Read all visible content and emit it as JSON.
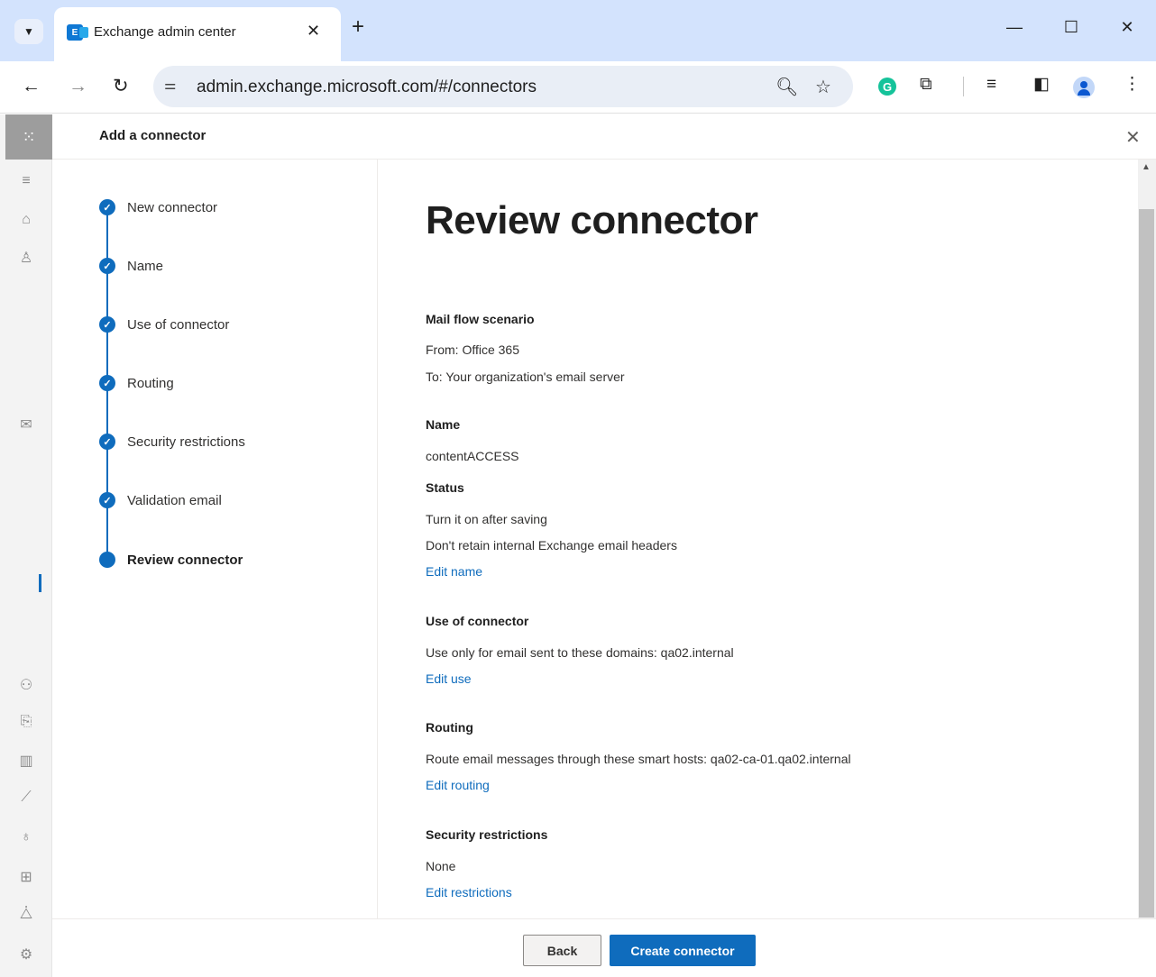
{
  "browser": {
    "tab_title": "Exchange admin center",
    "favicon_letter": "E",
    "url": "admin.exchange.microsoft.com/#/connectors",
    "icons": {
      "tab_dropdown": "chevron-down-icon",
      "tab_close": "close-icon",
      "new_tab": "plus-icon",
      "minimize": "minimize-icon",
      "maximize": "maximize-icon",
      "window_close": "close-icon",
      "back": "arrow-left-icon",
      "forward": "arrow-right-icon",
      "reload": "reload-icon",
      "site_info": "tune-icon",
      "zoom": "zoom-icon",
      "bookmark": "star-icon",
      "grammarly": "grammarly-icon",
      "extensions": "puzzle-icon",
      "media": "media-control-icon",
      "side_panel": "side-panel-icon",
      "profile": "avatar-icon",
      "menu": "more-vertical-icon"
    }
  },
  "rail": {
    "icons": [
      "app-launcher-icon",
      "hamburger-icon",
      "home-icon",
      "person-icon",
      "mail-icon",
      "roles-icon",
      "migration-icon",
      "reports-icon",
      "insights-icon",
      "lightbulb-icon",
      "public-folders-icon",
      "organization-icon",
      "settings-icon"
    ]
  },
  "panel": {
    "title": "Add a connector",
    "steps": [
      {
        "label": "New connector",
        "status": "completed"
      },
      {
        "label": "Name",
        "status": "completed"
      },
      {
        "label": "Use of connector",
        "status": "completed"
      },
      {
        "label": "Routing",
        "status": "completed"
      },
      {
        "label": "Security restrictions",
        "status": "completed"
      },
      {
        "label": "Validation email",
        "status": "completed"
      },
      {
        "label": "Review connector",
        "status": "current"
      }
    ]
  },
  "review": {
    "title": "Review connector",
    "mail_flow": {
      "heading": "Mail flow scenario",
      "from": "From: Office 365",
      "to": "To: Your organization's email server"
    },
    "name": {
      "heading": "Name",
      "value": "contentACCESS"
    },
    "status": {
      "heading": "Status",
      "line1": "Turn it on after saving",
      "line2": "Don't retain internal Exchange email headers",
      "edit": "Edit name"
    },
    "use": {
      "heading": "Use of connector",
      "value": "Use only for email sent to these domains: qa02.internal",
      "edit": "Edit use"
    },
    "routing": {
      "heading": "Routing",
      "value": "Route email messages through these smart hosts: qa02-ca-01.qa02.internal",
      "edit": "Edit routing"
    },
    "security": {
      "heading": "Security restrictions",
      "value": "None",
      "edit": "Edit restrictions"
    }
  },
  "footer": {
    "back_label": "Back",
    "create_label": "Create connector"
  },
  "colors": {
    "accent": "#0f6cbd",
    "tabbar": "#d3e3fd",
    "rail": "#f3f3f3"
  }
}
